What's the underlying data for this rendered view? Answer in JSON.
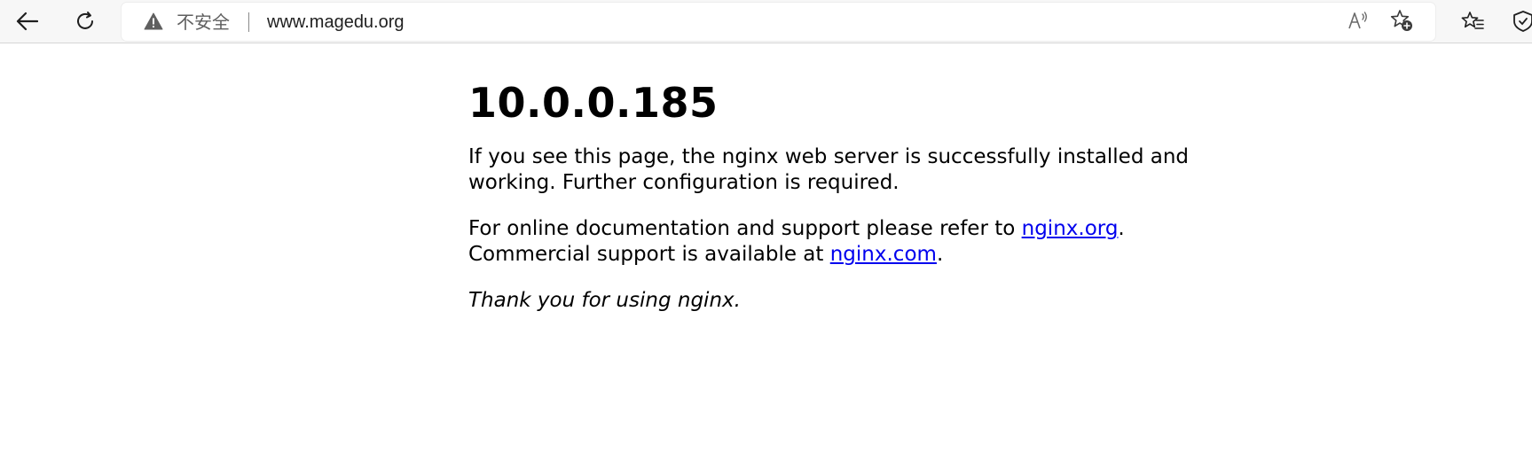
{
  "browser": {
    "security_label": "不安全",
    "url": "www.magedu.org",
    "icons": {
      "back": "back-arrow-icon",
      "refresh": "refresh-icon",
      "warning": "warning-triangle-icon",
      "read_aloud": "read-aloud-icon",
      "add_favorite": "add-favorite-icon",
      "favorites": "favorites-list-icon",
      "browser_essentials": "shield-icon"
    }
  },
  "page": {
    "heading": "10.0.0.185",
    "para1": "If you see this page, the nginx web server is successfully installed and working. Further configuration is required.",
    "para2_prefix": "For online documentation and support please refer to ",
    "para2_link1": "nginx.org",
    "para2_mid": ".",
    "para2_line2_prefix": "Commercial support is available at ",
    "para2_link2": "nginx.com",
    "para2_suffix": ".",
    "thanks": "Thank you for using nginx."
  },
  "colors": {
    "link": "#0000ee",
    "toolbar_bg": "#f7f7f7"
  }
}
